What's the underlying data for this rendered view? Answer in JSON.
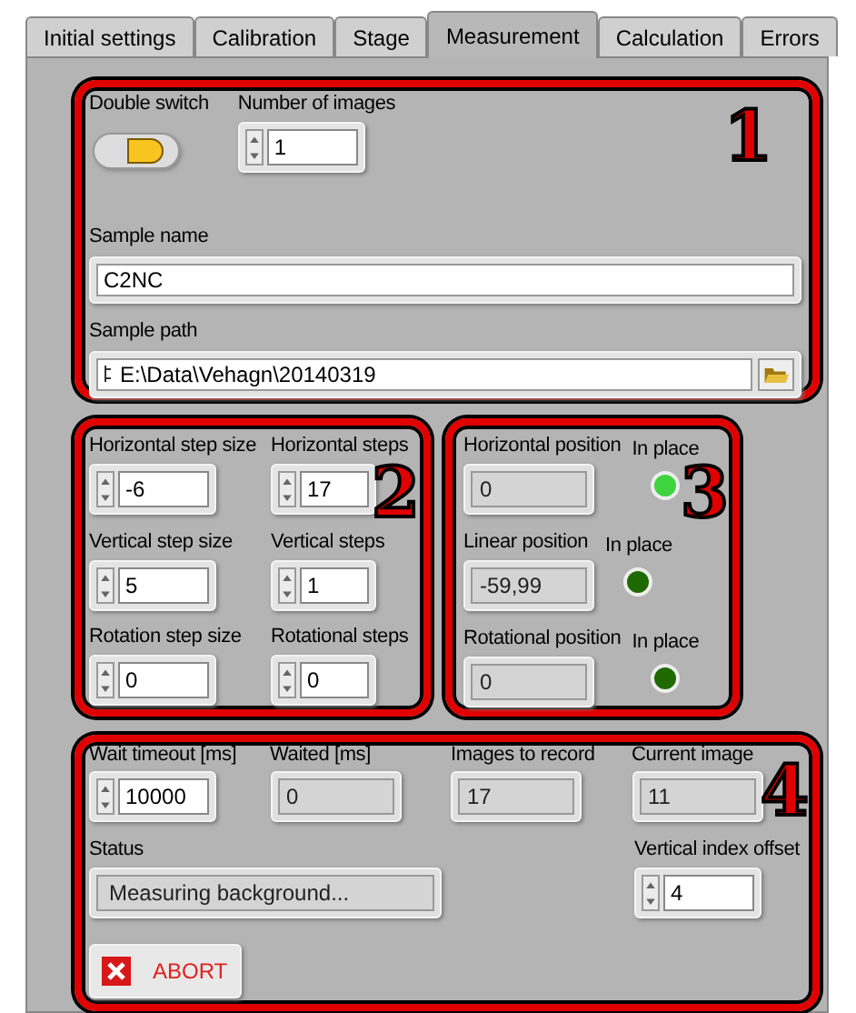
{
  "tabs": [
    {
      "label": "Initial settings",
      "selected": false
    },
    {
      "label": "Calibration",
      "selected": false
    },
    {
      "label": "Stage",
      "selected": false
    },
    {
      "label": "Measurement",
      "selected": true
    },
    {
      "label": "Calculation",
      "selected": false
    },
    {
      "label": "Errors",
      "selected": false
    }
  ],
  "section_1": {
    "annotation": "1",
    "double_switch": {
      "label": "Double switch",
      "on": true
    },
    "number_of_images": {
      "label": "Number of images",
      "value": "1"
    },
    "sample_name": {
      "label": "Sample name",
      "value": "C2NC"
    },
    "sample_path": {
      "label": "Sample path",
      "value": "E:\\Data\\Vehagn\\20140319"
    }
  },
  "section_2": {
    "annotation": "2",
    "controls": [
      {
        "label": "Horizontal step size",
        "value": "-6"
      },
      {
        "label": "Horizontal steps",
        "value": "17"
      },
      {
        "label": "Vertical step size",
        "value": "5"
      },
      {
        "label": "Vertical steps",
        "value": "1"
      },
      {
        "label": "Rotation step size",
        "value": "0"
      },
      {
        "label": "Rotational steps",
        "value": "0"
      }
    ]
  },
  "section_3": {
    "annotation": "3",
    "indicators": [
      {
        "label": "Horizontal position",
        "value": "0",
        "led_label": "In place",
        "on": true
      },
      {
        "label": "Linear position",
        "value": "-59,99",
        "led_label": "In place",
        "on": false
      },
      {
        "label": "Rotational position",
        "value": "0",
        "led_label": "In place",
        "on": false
      }
    ]
  },
  "section_4": {
    "annotation": "4",
    "fields": [
      {
        "kind": "control",
        "label": "Wait timeout [ms]",
        "value": "10000"
      },
      {
        "kind": "indicator",
        "label": "Waited [ms]",
        "value": "0"
      },
      {
        "kind": "indicator",
        "label": "Images to record",
        "value": "17"
      },
      {
        "kind": "indicator",
        "label": "Current image",
        "value": "11"
      }
    ],
    "status": {
      "label": "Status",
      "value": "Measuring background..."
    },
    "vertical_index_offset": {
      "label": "Vertical index offset",
      "value": "4"
    },
    "abort_button": "ABORT"
  }
}
